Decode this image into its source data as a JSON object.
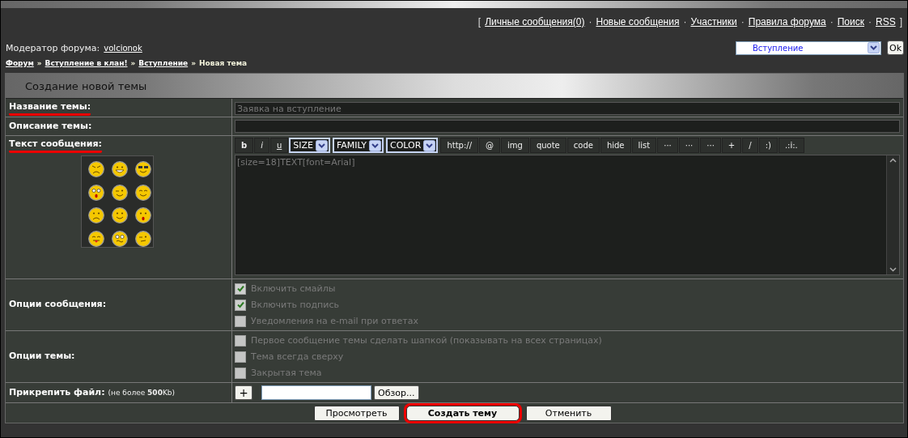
{
  "nav": [
    {
      "kind": "bracket",
      "text": "["
    },
    {
      "kind": "link",
      "text": "Личные сообщения(0)"
    },
    {
      "kind": "sep",
      "text": "·"
    },
    {
      "kind": "link",
      "text": "Новые сообщения"
    },
    {
      "kind": "sep",
      "text": "·"
    },
    {
      "kind": "link",
      "text": "Участники"
    },
    {
      "kind": "sep",
      "text": "·"
    },
    {
      "kind": "link",
      "text": "Правила форума"
    },
    {
      "kind": "sep",
      "text": "·"
    },
    {
      "kind": "link",
      "text": "Поиск"
    },
    {
      "kind": "sep",
      "text": "·"
    },
    {
      "kind": "link",
      "text": "RSS"
    },
    {
      "kind": "bracket",
      "text": "]"
    }
  ],
  "moderator": {
    "label": "Модератор форума:",
    "name": "volcionok"
  },
  "forum_select": {
    "value": "Вступление",
    "button": "Ok"
  },
  "breadcrumb": [
    {
      "kind": "link",
      "text": "Форум"
    },
    {
      "kind": "sep",
      "text": "»"
    },
    {
      "kind": "link",
      "text": "Вступление в клан!"
    },
    {
      "kind": "sep",
      "text": "»"
    },
    {
      "kind": "link",
      "text": "Вступление"
    },
    {
      "kind": "sep",
      "text": "»"
    },
    {
      "kind": "current",
      "text": "Новая тема"
    }
  ],
  "panel_title": "Создание новой темы",
  "title_field": {
    "label": "Название темы:",
    "annotated": true,
    "placeholder": "Заявка на вступление"
  },
  "description_field": {
    "label": "Описание темы:",
    "annotated": false
  },
  "message": {
    "label": "Текст сообщения:",
    "annotated": true,
    "value": "[size=18]TEXT[font=Arial]",
    "toolbar": [
      {
        "kind": "bold",
        "text": "b"
      },
      {
        "kind": "italic",
        "text": "i"
      },
      {
        "kind": "underline",
        "text": "u"
      },
      {
        "kind": "select",
        "text": "SIZE"
      },
      {
        "kind": "select",
        "text": "FAMILY"
      },
      {
        "kind": "select",
        "text": "COLOR"
      },
      {
        "kind": "button",
        "text": "http://"
      },
      {
        "kind": "button",
        "text": "@"
      },
      {
        "kind": "button",
        "text": "img"
      },
      {
        "kind": "button",
        "text": "quote"
      },
      {
        "kind": "button",
        "text": "code"
      },
      {
        "kind": "button",
        "text": "hide"
      },
      {
        "kind": "button",
        "text": "list"
      },
      {
        "kind": "button",
        "text": "···"
      },
      {
        "kind": "button",
        "text": "···"
      },
      {
        "kind": "button",
        "text": "···"
      },
      {
        "kind": "button",
        "text": "+"
      },
      {
        "kind": "button",
        "text": "/"
      },
      {
        "kind": "button",
        "text": ":)"
      },
      {
        "kind": "button",
        "text": ".:i:."
      }
    ]
  },
  "message_options": {
    "label": "Опции сообщения:",
    "items": [
      {
        "text": "Включить смайлы",
        "checked": true
      },
      {
        "text": "Включить подпись",
        "checked": true
      },
      {
        "text": "Уведомления на e-mail при ответах",
        "checked": false
      }
    ]
  },
  "topic_options": {
    "label": "Опции темы:",
    "items": [
      {
        "text": "Первое сообщение темы сделать шапкой (показывать на всех страницах)",
        "checked": false
      },
      {
        "text": "Тема всегда сверху",
        "checked": false
      },
      {
        "text": "Закрытая тема",
        "checked": false
      }
    ]
  },
  "attach": {
    "label": "Прикрепить файл:",
    "note": "(не более **500**Kb)",
    "add": "+",
    "browse": "Обзор..."
  },
  "actions": [
    {
      "text": "Просмотреть",
      "primary": false,
      "annotated": false
    },
    {
      "text": "Создать тему",
      "primary": true,
      "annotated": true
    },
    {
      "text": "Отменить",
      "primary": false,
      "annotated": false
    }
  ]
}
